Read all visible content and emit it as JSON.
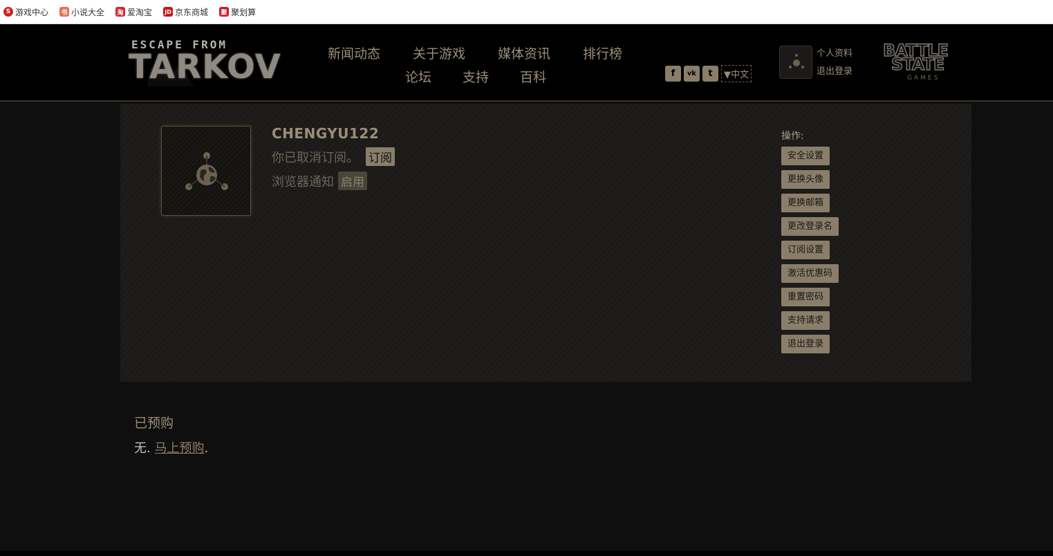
{
  "bookmarks": [
    {
      "label": "游戏中心",
      "icon": "game-center-icon",
      "color": "#d0201f",
      "glyph": "S"
    },
    {
      "label": "小说大全",
      "icon": "novel-icon",
      "color": "#f26a4f",
      "glyph": "书"
    },
    {
      "label": "爱淘宝",
      "icon": "taobao-icon",
      "color": "#d9262a",
      "glyph": "淘"
    },
    {
      "label": "京东商城",
      "icon": "jd-icon",
      "color": "#c8161d",
      "glyph": "JD"
    },
    {
      "label": "聚划算",
      "icon": "juhuasuan-icon",
      "color": "#d6152b",
      "glyph": "聚"
    }
  ],
  "header": {
    "logo_line1": "ESCAPE FROM",
    "logo_line2": "TARKOV",
    "nav_row1": [
      "新闻动态",
      "关于游戏",
      "媒体资讯",
      "排行榜"
    ],
    "nav_row2": [
      "论坛",
      "支持",
      "百科"
    ],
    "social": [
      {
        "icon": "facebook-icon",
        "glyph": "f"
      },
      {
        "icon": "vk-icon",
        "glyph": "vk"
      },
      {
        "icon": "twitter-icon",
        "glyph": "t"
      }
    ],
    "language": "▼中文",
    "profile_link": "个人资料",
    "logout_link": "退出登录",
    "bsg_line1": "BATTLE",
    "bsg_line2": "STATE",
    "bsg_line3": "GAMES"
  },
  "profile": {
    "username": "CHENGYU122",
    "subscription_text": "你已取消订阅。",
    "subscribe_button": "订阅",
    "browser_notify_text": "浏览器通知",
    "enable_button": "启用",
    "actions_label": "操作:",
    "actions": [
      "安全设置",
      "更换头像",
      "更换邮箱",
      "更改登录名",
      "订阅设置",
      "激活优惠码",
      "重置密码",
      "支持请求",
      "退出登录"
    ]
  },
  "preorder": {
    "title": "已预购",
    "none_text": "无. ",
    "link_text": "马上预购",
    "suffix": "."
  },
  "colors": {
    "accent": "#8a7e6a",
    "text_gold": "#9a8e78",
    "background": "#0f0f0f"
  }
}
